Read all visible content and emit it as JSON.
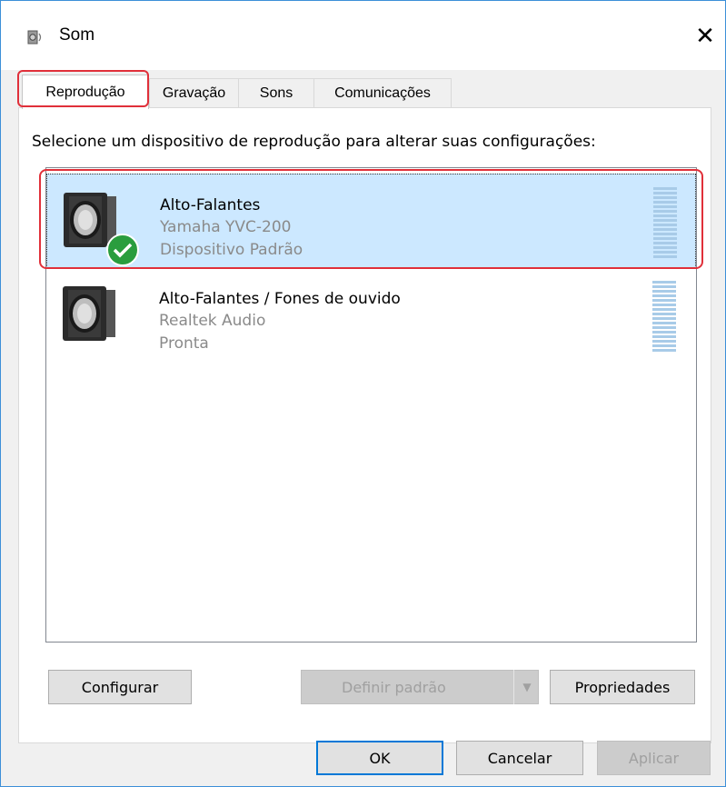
{
  "window": {
    "title": "Som",
    "close_glyph": "✕"
  },
  "tabs": [
    {
      "label": "Reprodução",
      "active": true
    },
    {
      "label": "Gravação",
      "active": false
    },
    {
      "label": "Sons",
      "active": false
    },
    {
      "label": "Comunicações",
      "active": false
    }
  ],
  "instruction": "Selecione um dispositivo de reprodução para alterar suas configurações:",
  "devices": [
    {
      "name": "Alto-Falantes",
      "model": "Yamaha YVC-200",
      "status": "Dispositivo Padrão",
      "selected": true,
      "default_badge": "check-icon"
    },
    {
      "name": "Alto-Falantes / Fones de ouvido",
      "model": "Realtek Audio",
      "status": "Pronta",
      "selected": false
    }
  ],
  "actions": {
    "configure": "Configurar",
    "set_default": "Definir padrão",
    "properties": "Propriedades"
  },
  "footer": {
    "ok": "OK",
    "cancel": "Cancelar",
    "apply": "Aplicar"
  },
  "colors": {
    "accent": "#0078d7",
    "selection": "#cce8ff",
    "highlight": "#e0303a",
    "check": "#2a9d3e"
  }
}
